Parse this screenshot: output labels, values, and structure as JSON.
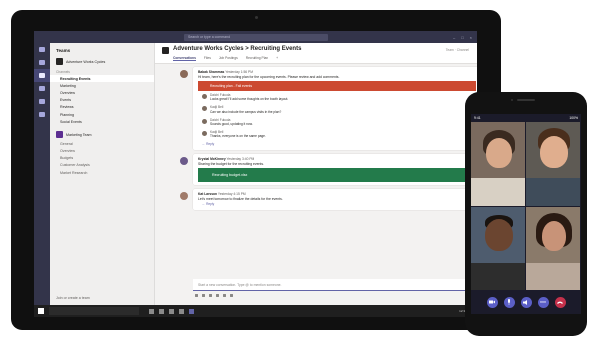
{
  "teams_app": {
    "title_bar": {
      "search_placeholder": "Search or type a command",
      "window_controls": [
        "–",
        "□",
        "×"
      ]
    },
    "rail_icons": [
      "activity-icon",
      "chat-icon",
      "teams-icon",
      "calendar-icon",
      "calls-icon",
      "files-icon"
    ],
    "teams_panel": {
      "header": "Teams",
      "teams": [
        {
          "name": "Adventure Works Cycles"
        }
      ],
      "section_label": "Channels",
      "channels": [
        {
          "name": "Recruiting Events",
          "active": true
        },
        {
          "name": "Marketing",
          "active": false
        },
        {
          "name": "Overview",
          "active": false
        },
        {
          "name": "Events",
          "active": false
        },
        {
          "name": "Reviews",
          "active": false
        },
        {
          "name": "Planning",
          "active": false
        },
        {
          "name": "Social Events",
          "active": false
        }
      ],
      "second_team": {
        "name": "Marketing Team"
      },
      "second_team_channels": [
        "General",
        "Overview",
        "Budgets",
        "Customer Analysis",
        "Market Research"
      ],
      "footer": "Join or create a team"
    },
    "channel": {
      "title": "Adventure Works Cycles > Recruiting Events",
      "right_info": "Team · Channel",
      "tabs": [
        {
          "label": "Conversations",
          "active": true
        },
        {
          "label": "Files",
          "active": false
        },
        {
          "label": "Job Postings",
          "active": false
        },
        {
          "label": "Recruiting Plan",
          "active": false
        },
        {
          "label": "+",
          "active": false
        }
      ]
    },
    "feed": {
      "post1": {
        "author": "Babak Shammas",
        "time": "Yesterday 1:56 PM",
        "text": "Hi team, here's the recruiting plan for the upcoming events. Please review and add comments.",
        "banner": "Recruiting plan - Fall events"
      },
      "replies": [
        {
          "name": "Daichi Fukuda",
          "text": "Looks great! I'll add some thoughts on the booth layout."
        },
        {
          "name": "Kadji Bell",
          "text": "Can we also include the campus visits in the plan?"
        },
        {
          "name": "Daichi Fukuda",
          "text": "Sounds good, updating it now."
        },
        {
          "name": "Kadji Bell",
          "text": "Thanks, everyone is on the same page."
        }
      ],
      "reply_link": "← Reply",
      "post2": {
        "author": "Krystal McKinney",
        "time": "Yesterday 3:40 PM",
        "text": "Sharing the budget for the recruiting events.",
        "banner": "Recruiting budget.xlsx"
      },
      "post3": {
        "author": "Kat Larsson",
        "time": "Yesterday 4:15 PM",
        "text": "Let's meet tomorrow to finalize the details for the events."
      },
      "reply_link2": "← Reply"
    },
    "compose_placeholder": "Start a new conversation. Type @ to mention someone.",
    "taskbar": {
      "clock": "12:30 PM"
    }
  },
  "phone": {
    "status_time": "9:41",
    "status_battery": "100%"
  },
  "colors": {
    "teams_purple": "#6264a7",
    "rail_dark": "#33344a",
    "alert_red": "#cc4a31",
    "excel_green": "#237b4b",
    "hangup_red": "#c4314b"
  }
}
